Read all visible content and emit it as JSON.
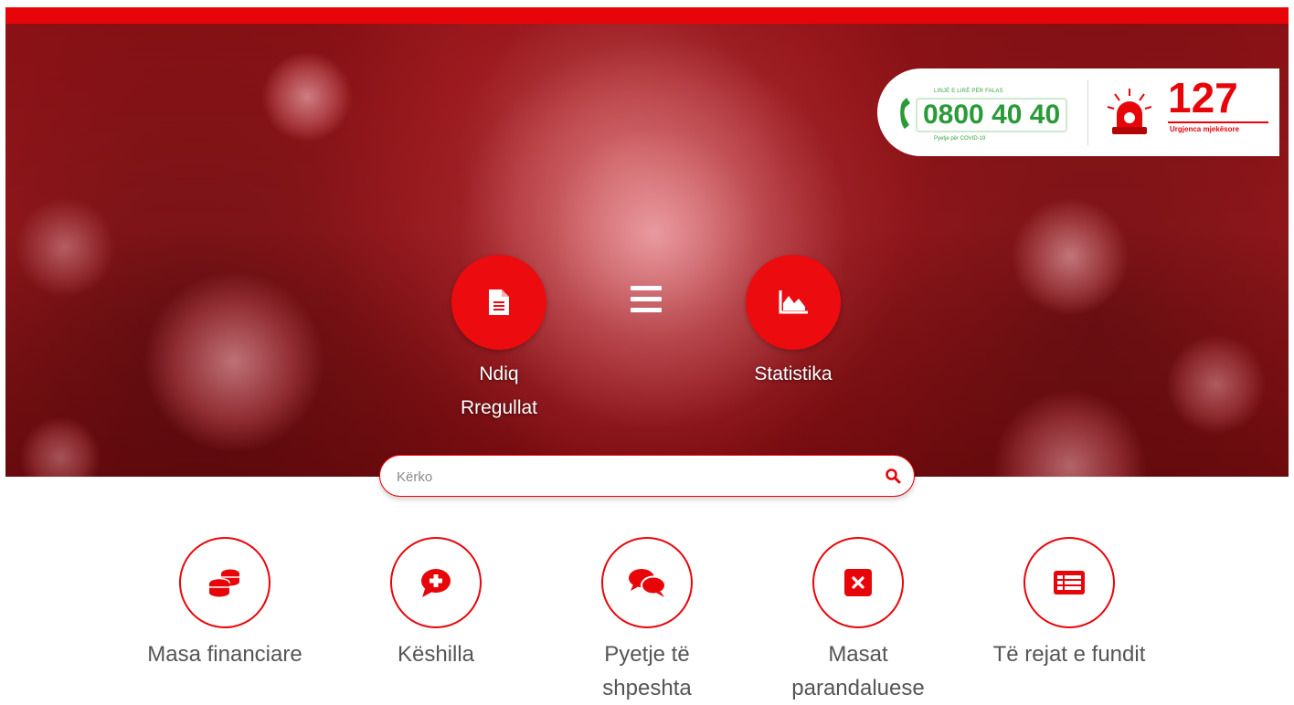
{
  "hotline": {
    "green_top": "LINJË E LIRË PËR FALAS",
    "green_number": "0800 40 40",
    "green_bottom": "Pyetje për COVID-19",
    "emergency_number": "127",
    "emergency_label": "Urgjenca mjekësore"
  },
  "hero": {
    "rules_label_line1": "Ndiq",
    "rules_label_line2": "Rregullat",
    "stats_label": "Statistika"
  },
  "search": {
    "placeholder": "Kërko"
  },
  "features": [
    {
      "label": "Masa financiare",
      "icon": "coins-icon"
    },
    {
      "label": "Këshilla",
      "icon": "comment-plus-icon"
    },
    {
      "label_line1": "Pyetje të",
      "label_line2": "shpeshta",
      "icon": "comments-icon"
    },
    {
      "label_line1": "Masat",
      "label_line2": "parandaluese",
      "icon": "cross-box-icon"
    },
    {
      "label": "Të rejat e fundit",
      "icon": "news-list-icon"
    }
  ],
  "colors": {
    "accent": "#e8050a",
    "hotline_green": "#2a9a38",
    "text_gray": "#555555"
  }
}
